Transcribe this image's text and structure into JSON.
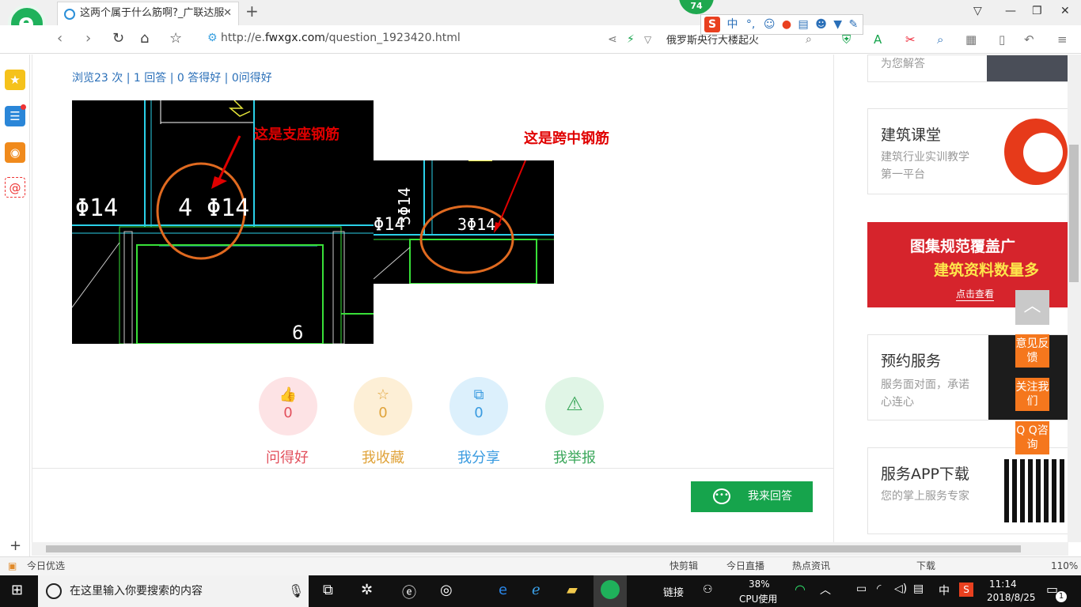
{
  "browser": {
    "tab_title": "这两个属于什么筋啊?_广联达服",
    "tab_close": "✕",
    "new_tab": "+",
    "notification_count": "74",
    "url_prefix": "http://e.",
    "url_domain": "fwxgx.com",
    "url_path": "/question_1923420.html",
    "search_value": "俄罗斯央行大楼起火"
  },
  "ime": {
    "logo": "S",
    "mode": "中"
  },
  "content": {
    "stats": "浏览23 次 | 1 回答 | 0 答得好 | 0问得好",
    "image1": {
      "label": "这是支座钢筋",
      "rebar_left": "Φ14",
      "rebar_main": "4 Φ14",
      "mark": "6"
    },
    "image2": {
      "label": "这是跨中钢筋",
      "rebar_left": "Φ14",
      "rebar_vert": "3Φ14",
      "rebar_main": "3Φ14"
    },
    "actions": [
      {
        "icon": "thumb-up-icon",
        "count": "0",
        "label": "问得好",
        "color": "#e2505c",
        "bg": "#fde3e5"
      },
      {
        "icon": "star-icon",
        "count": "0",
        "label": "我收藏",
        "color": "#e0a33a",
        "bg": "#fdefd6"
      },
      {
        "icon": "share-icon",
        "count": "0",
        "label": "我分享",
        "color": "#3a9be0",
        "bg": "#dcf0fc"
      },
      {
        "icon": "warning-icon",
        "count": "0",
        "label": "我举报",
        "color": "#3aa75a",
        "bg": "#e0f5e6"
      }
    ],
    "answer_button": "我来回答",
    "answer_icon_glyph": "•••"
  },
  "right": {
    "card0_desc": "为您解答",
    "cards": [
      {
        "title": "建筑课堂",
        "desc": "建筑行业实训教学第一平台"
      },
      {
        "title": "预约服务",
        "desc": "服务面对面，承诺心连心"
      },
      {
        "title": "服务APP下载",
        "desc": "您的掌上服务专家"
      }
    ],
    "banner": {
      "line1": "图集规范覆盖广",
      "line2": "建筑资料数量多",
      "link": "点击查看"
    },
    "float_buttons": [
      "意见反馈",
      "关注我们",
      "Q Q咨询"
    ],
    "to_top_glyph": "︿"
  },
  "statusbar": {
    "left": "今日优选",
    "items": [
      "快剪辑",
      "今日直播",
      "热点资讯",
      "下载"
    ],
    "zoom": "110%"
  },
  "taskbar": {
    "search_placeholder": "在这里输入你要搜索的内容",
    "link_label": "链接",
    "cpu_percent": "38%",
    "cpu_label": "CPU使用",
    "ime": "中",
    "time": "11:14",
    "date": "2018/8/25",
    "notif_count": "1"
  },
  "colors": {
    "accent_green": "#16a44c",
    "link_blue": "#2a6fb8",
    "label_red": "#e00000",
    "orange": "#f5771d"
  }
}
